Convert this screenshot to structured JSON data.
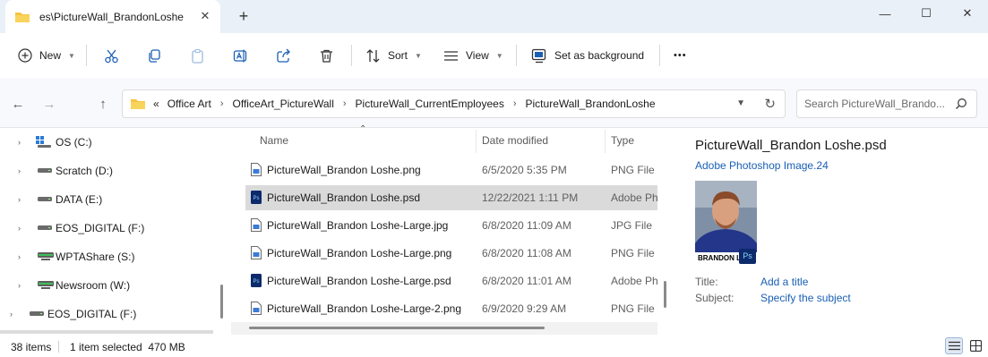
{
  "window": {
    "tab_title": "es\\PictureWall_BrandonLoshe",
    "tab_close": "✕",
    "new_tab": "+",
    "minimize": "—",
    "maximize": "☐",
    "close": "✕"
  },
  "toolbar": {
    "new_label": "New",
    "sort_label": "Sort",
    "view_label": "View",
    "set_background_label": "Set as background",
    "more_label": "•••",
    "icons": [
      "plus-circle-icon",
      "cut-icon",
      "copy-icon",
      "paste-icon",
      "rename-icon",
      "share-icon",
      "delete-icon",
      "sort-icon",
      "view-icon",
      "set-background-icon",
      "more-icon"
    ]
  },
  "address": {
    "overflow": "«",
    "separator": "›",
    "crumbs": [
      "Office Art",
      "OfficeArt_PictureWall",
      "PictureWall_CurrentEmployees",
      "PictureWall_BrandonLoshe"
    ],
    "dropdown": "⌄",
    "refresh": "↻"
  },
  "nav_buttons": {
    "back": "←",
    "forward": "→",
    "up": "↑"
  },
  "search": {
    "placeholder": "Search PictureWall_Brando..."
  },
  "nav_pane": {
    "items": [
      {
        "label": "OS (C:)",
        "icon": "windows-drive-icon",
        "expander": "›"
      },
      {
        "label": "Scratch (D:)",
        "icon": "drive-icon",
        "expander": "›"
      },
      {
        "label": "DATA (E:)",
        "icon": "drive-icon",
        "expander": "›"
      },
      {
        "label": "EOS_DIGITAL (F:)",
        "icon": "drive-icon",
        "expander": "›"
      },
      {
        "label": "WPTAShare (S:)",
        "icon": "network-drive-icon",
        "expander": "›"
      },
      {
        "label": "Newsroom (W:)",
        "icon": "network-drive-icon",
        "expander": "›"
      },
      {
        "label": "EOS_DIGITAL (F:)",
        "icon": "drive-icon",
        "expander": "›"
      }
    ]
  },
  "file_list": {
    "columns": {
      "name": "Name",
      "date": "Date modified",
      "type": "Type"
    },
    "sort_indicator": "⌃",
    "rows": [
      {
        "name": "PictureWall_Brandon Loshe.png",
        "date": "6/5/2020 5:35 PM",
        "type": "PNG File",
        "icon": "png-file-icon",
        "selected": false
      },
      {
        "name": "PictureWall_Brandon Loshe.psd",
        "date": "12/22/2021 1:11 PM",
        "type": "Adobe Ph",
        "icon": "psd-file-icon",
        "selected": true
      },
      {
        "name": "PictureWall_Brandon Loshe-Large.jpg",
        "date": "6/8/2020 11:09 AM",
        "type": "JPG File",
        "icon": "jpg-file-icon",
        "selected": false
      },
      {
        "name": "PictureWall_Brandon Loshe-Large.png",
        "date": "6/8/2020 11:08 AM",
        "type": "PNG File",
        "icon": "png-file-icon",
        "selected": false
      },
      {
        "name": "PictureWall_Brandon Loshe-Large.psd",
        "date": "6/8/2020 11:01 AM",
        "type": "Adobe Ph",
        "icon": "psd-file-icon",
        "selected": false
      },
      {
        "name": "PictureWall_Brandon Loshe-Large-2.png",
        "date": "6/9/2020 9:29 AM",
        "type": "PNG File",
        "icon": "png-file-icon",
        "selected": false
      }
    ]
  },
  "details": {
    "file_name": "PictureWall_Brandon Loshe.psd",
    "file_type": "Adobe Photoshop Image.24",
    "thumbnail_caption": "BRANDON LO",
    "thumbnail_badge": "Ps",
    "title_label": "Title:",
    "title_value": "Add a title",
    "subject_label": "Subject:",
    "subject_value": "Specify the subject"
  },
  "status": {
    "item_count": "38 items",
    "selection": "1 item selected  470 MB"
  },
  "colors": {
    "accent": "#1a5fb4",
    "selected_row": "#dadada",
    "titlebar": "#eaf0f7",
    "folder": "#f6c343",
    "psd_blue": "#0d2a6b"
  }
}
